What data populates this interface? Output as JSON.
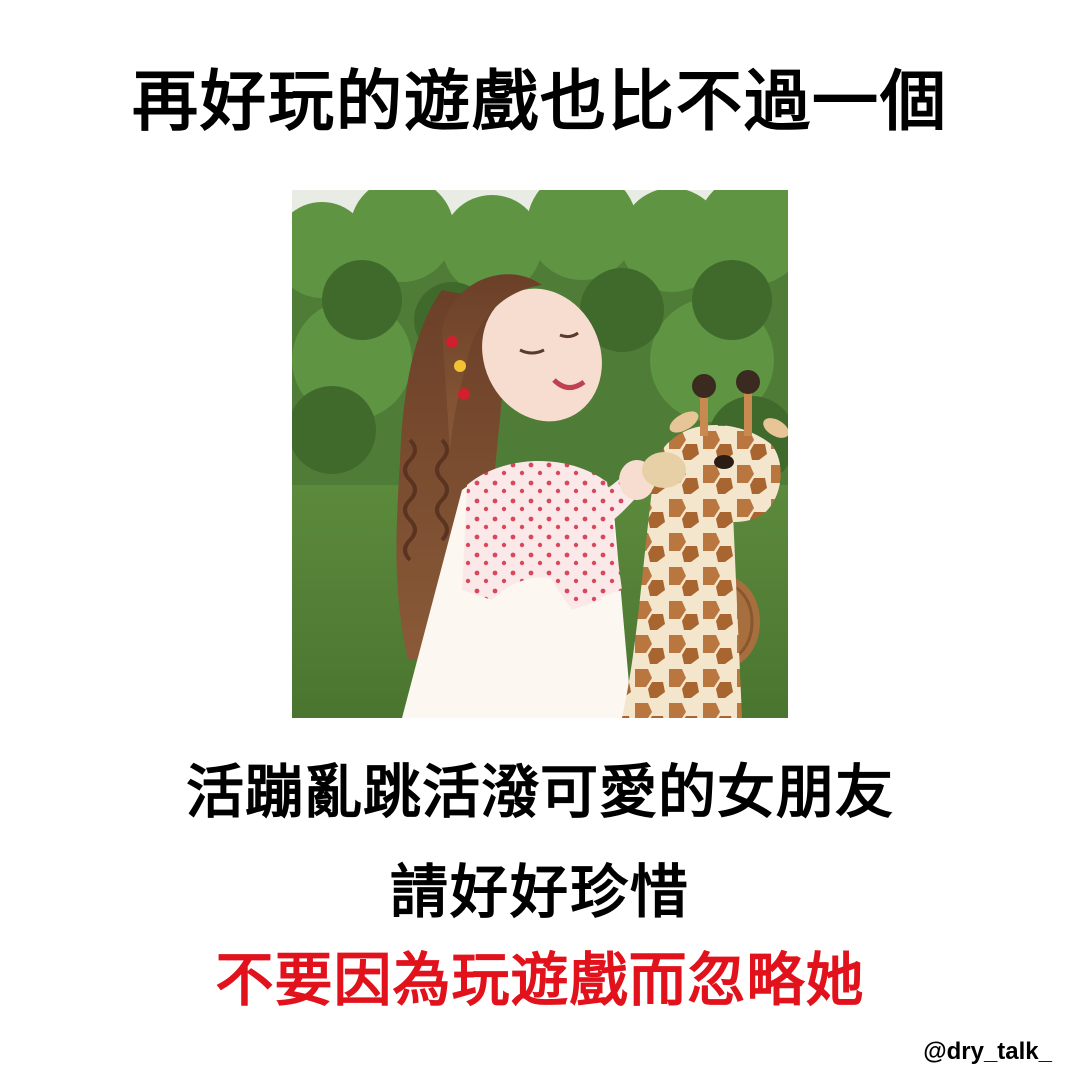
{
  "headline": "再好玩的遊戲也比不過一個",
  "caption": {
    "line1": "活蹦亂跳活潑可愛的女朋友",
    "line2": "請好好珍惜",
    "line3": "不要因為玩遊戲而忽略她"
  },
  "watermark": "@dry_talk_",
  "colors": {
    "text": "#000000",
    "highlight": "#e1121c",
    "background": "#ffffff"
  },
  "photo": {
    "subject": "smiling girl with long wavy brown hair in a floral blouse beside a plush giraffe, green hedge and lawn behind"
  }
}
